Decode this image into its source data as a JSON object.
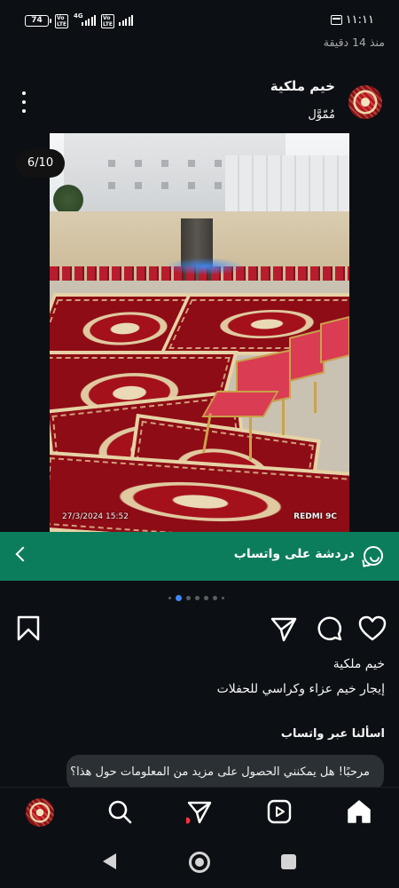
{
  "status_bar": {
    "battery": "74",
    "net1": "Vo LTE",
    "net2": "4G",
    "net3": "Vo LTE",
    "time": "١١:١١"
  },
  "post": {
    "time_ago": "منذ 14 دقيقة",
    "user_name": "خيم ملكية",
    "sponsored": "مُمّوَّل",
    "counter": "6/10",
    "photo_timestamp": "27/3/2024 15:52",
    "photo_camera": "REDMI 9C",
    "photo_icons": {
      "more": "more-vertical-icon"
    }
  },
  "whatsapp_bar": {
    "label": "دردشة على واتساب",
    "icon": "whatsapp-icon",
    "chevron": "chevron-left-icon",
    "color": "#0c7d5c"
  },
  "carousel": {
    "total": 7,
    "active_index": 1,
    "active_color": "#3f87f5"
  },
  "actions": {
    "like": "heart-icon",
    "comment": "comment-icon",
    "share": "send-icon",
    "save": "bookmark-icon"
  },
  "caption": {
    "user": "خيم ملكية",
    "text": "إيجار خيم عزاء وكراسي للحفلات"
  },
  "ask_whatsapp": {
    "title": "اسألنا عبر واتساب",
    "message": "مرحبًا! هل يمكنني الحصول على مزيد من المعلومات حول هذا؟"
  },
  "bottom_nav": {
    "items": [
      "home-icon",
      "reels-icon",
      "send-icon",
      "search-icon",
      "profile-avatar"
    ]
  }
}
